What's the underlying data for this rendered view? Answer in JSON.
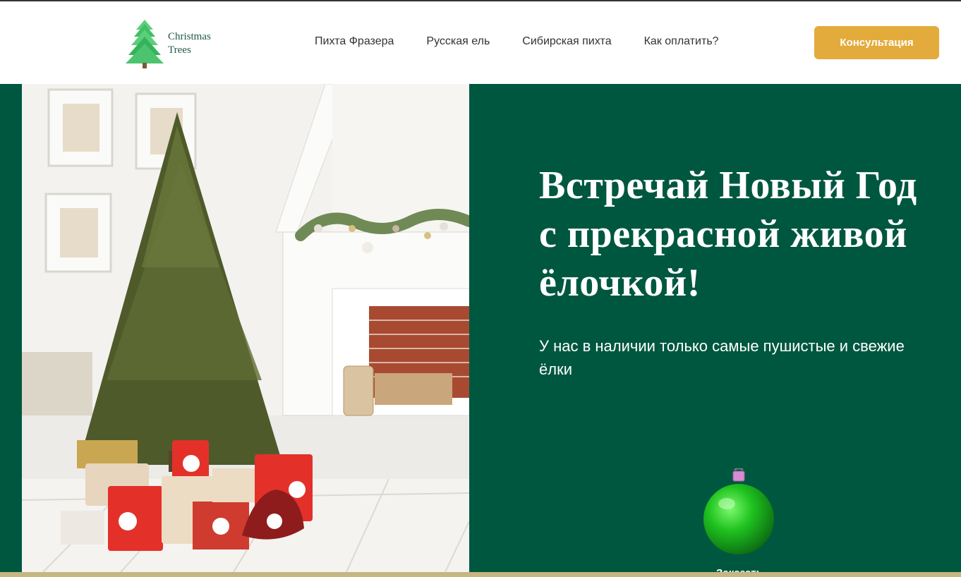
{
  "logo": {
    "icon": "tree-icon",
    "line1": "Christmas",
    "line2": "Trees"
  },
  "nav": {
    "items": [
      {
        "label": "Пихта Фразера"
      },
      {
        "label": "Русская ель"
      },
      {
        "label": "Сибирская пихта"
      },
      {
        "label": "Как оплатить?"
      }
    ]
  },
  "header": {
    "cta_label": "Консультация"
  },
  "hero": {
    "title_line1": "Встречай Новый Год",
    "title_line2": "с прекрасной живой",
    "title_line3": "ёлочкой!",
    "subtitle": "У нас в наличии только самые пушистые и свежие ёлки",
    "order_label": "Заказать",
    "order_icon": "christmas-ball-icon"
  },
  "colors": {
    "brand_green": "#00573f",
    "accent_gold": "#e3ab3b",
    "bottom_strip": "#c6b681"
  }
}
